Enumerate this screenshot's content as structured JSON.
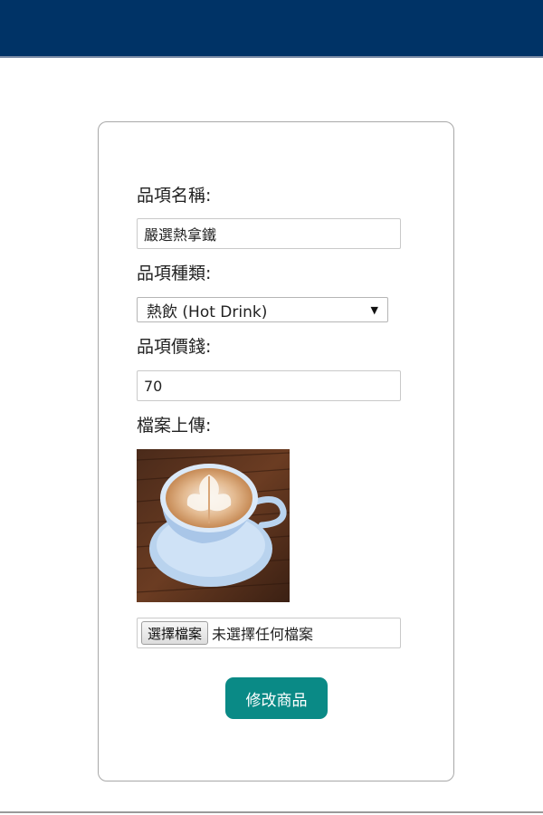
{
  "form": {
    "name_label": "品項名稱:",
    "name_value": "嚴選熱拿鐵",
    "category_label": "品項種類:",
    "category_selected": "熱飲 (Hot Drink)",
    "price_label": "品項價錢:",
    "price_value": "70",
    "upload_label": "檔案上傳:",
    "file_button_label": "選擇檔案",
    "file_status": "未選擇任何檔案",
    "submit_label": "修改商品"
  },
  "colors": {
    "header_bar": "#003366",
    "submit_button": "#0a8a86"
  },
  "icons": {
    "select_arrow": "dropdown-arrow-icon"
  }
}
